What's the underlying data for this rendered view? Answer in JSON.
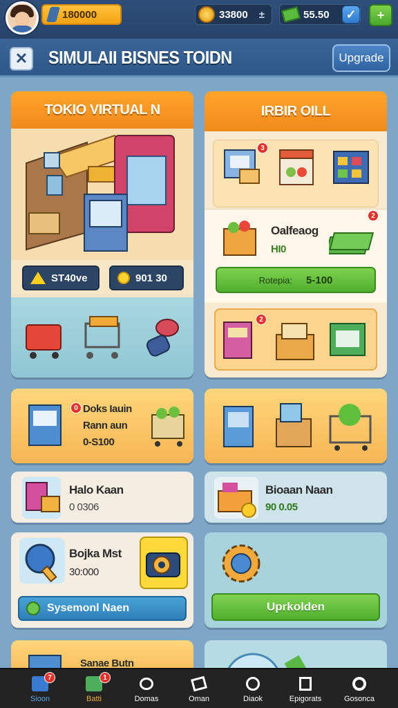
{
  "header": {
    "currency1": "180000",
    "currency2": "33800",
    "currency3": "55.50",
    "title": "SIMULAII BISNES TOIDN",
    "upgrade": "Upgrade",
    "plus": "+",
    "check": "✓"
  },
  "cards": {
    "toko": {
      "title": "TOKIO VIRTUAL N",
      "btn1": "ST40ve",
      "btn2": "901 30"
    },
    "rbar": {
      "title": "IRBIR OILL",
      "badge1": "3",
      "badge2": "2",
      "badge3": "2",
      "item_name": "Oalfeaog",
      "item_value": "HI0",
      "green_label": "Rotepia:",
      "green_value": "5-100"
    },
    "mid_left": {
      "badge": "0",
      "line1": "Doks Iauin",
      "line2": "Rann aun",
      "line3": "0-S100"
    },
    "row2_left": {
      "name": "Halo Kaan",
      "value": "0 0306"
    },
    "row2_right": {
      "name": "Bioaan Naan",
      "value": "90 0.05"
    },
    "row3_left": {
      "name": "Bojka Mst",
      "value": "30:000",
      "bar": "Sysemonl Naen"
    },
    "row3_right": {
      "button": "Uprkolden"
    },
    "bottom_left": {
      "name": "Sanae Butn"
    }
  },
  "tabs": [
    {
      "label": "Sioon",
      "icon": "home-icon",
      "badge": "7"
    },
    {
      "label": "Batti",
      "icon": "shop-icon",
      "badge": "1"
    },
    {
      "label": "Domas",
      "icon": "chat-icon"
    },
    {
      "label": "Oman",
      "icon": "box-icon",
      "badge": ""
    },
    {
      "label": "Diaok",
      "icon": "clock-icon"
    },
    {
      "label": "Epigorats",
      "icon": "stats-icon"
    },
    {
      "label": "Gosonca",
      "icon": "settings-icon"
    }
  ],
  "colors": {
    "accent_orange": "#f08a1a",
    "accent_green": "#4fae2d",
    "accent_blue": "#2f62a0"
  }
}
